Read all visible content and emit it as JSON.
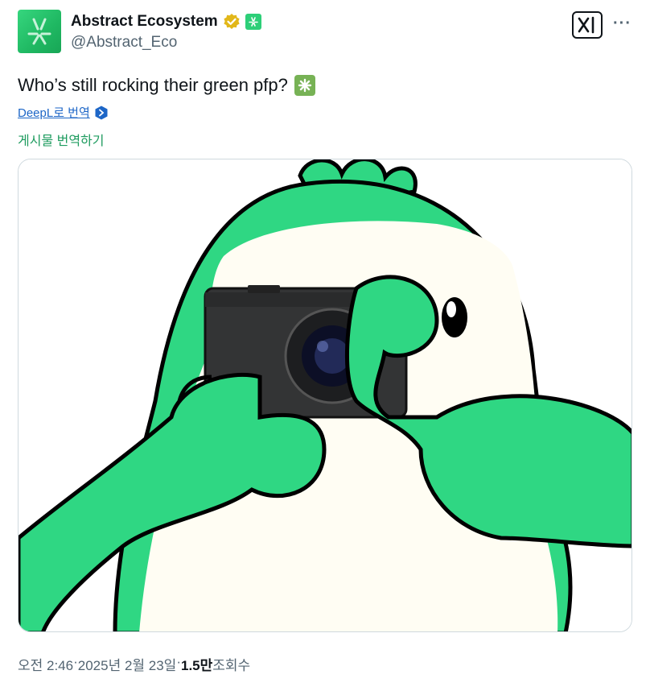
{
  "author": {
    "display_name": "Abstract Ecosystem",
    "handle": "@Abstract_Eco",
    "avatar_icon": "abstract-logo-icon",
    "verified_icon": "verified-gold-badge-icon",
    "affiliate_icon": "affiliate-badge-icon"
  },
  "toolbar": {
    "grok_icon": "grok-x-logo-icon",
    "more_label": "···"
  },
  "tweet": {
    "text": "Who’s still rocking their green pfp?",
    "emoji": "sparkle-emoji-icon",
    "deepl_label": "DeepL로 번역",
    "translate_label": "게시물 번역하기"
  },
  "media": {
    "image_icon": "green-penguin-camera-image"
  },
  "meta": {
    "time": "오전 2:46",
    "sep1": " · ",
    "date": "2025년 2월 23일",
    "sep2": " · ",
    "views_count": "1.5만",
    "views_label": " 조회수"
  },
  "colors": {
    "brand_green": "#2fd783",
    "link_blue": "#1d66c7",
    "translate_green": "#1d9b5e",
    "muted": "#536471"
  }
}
